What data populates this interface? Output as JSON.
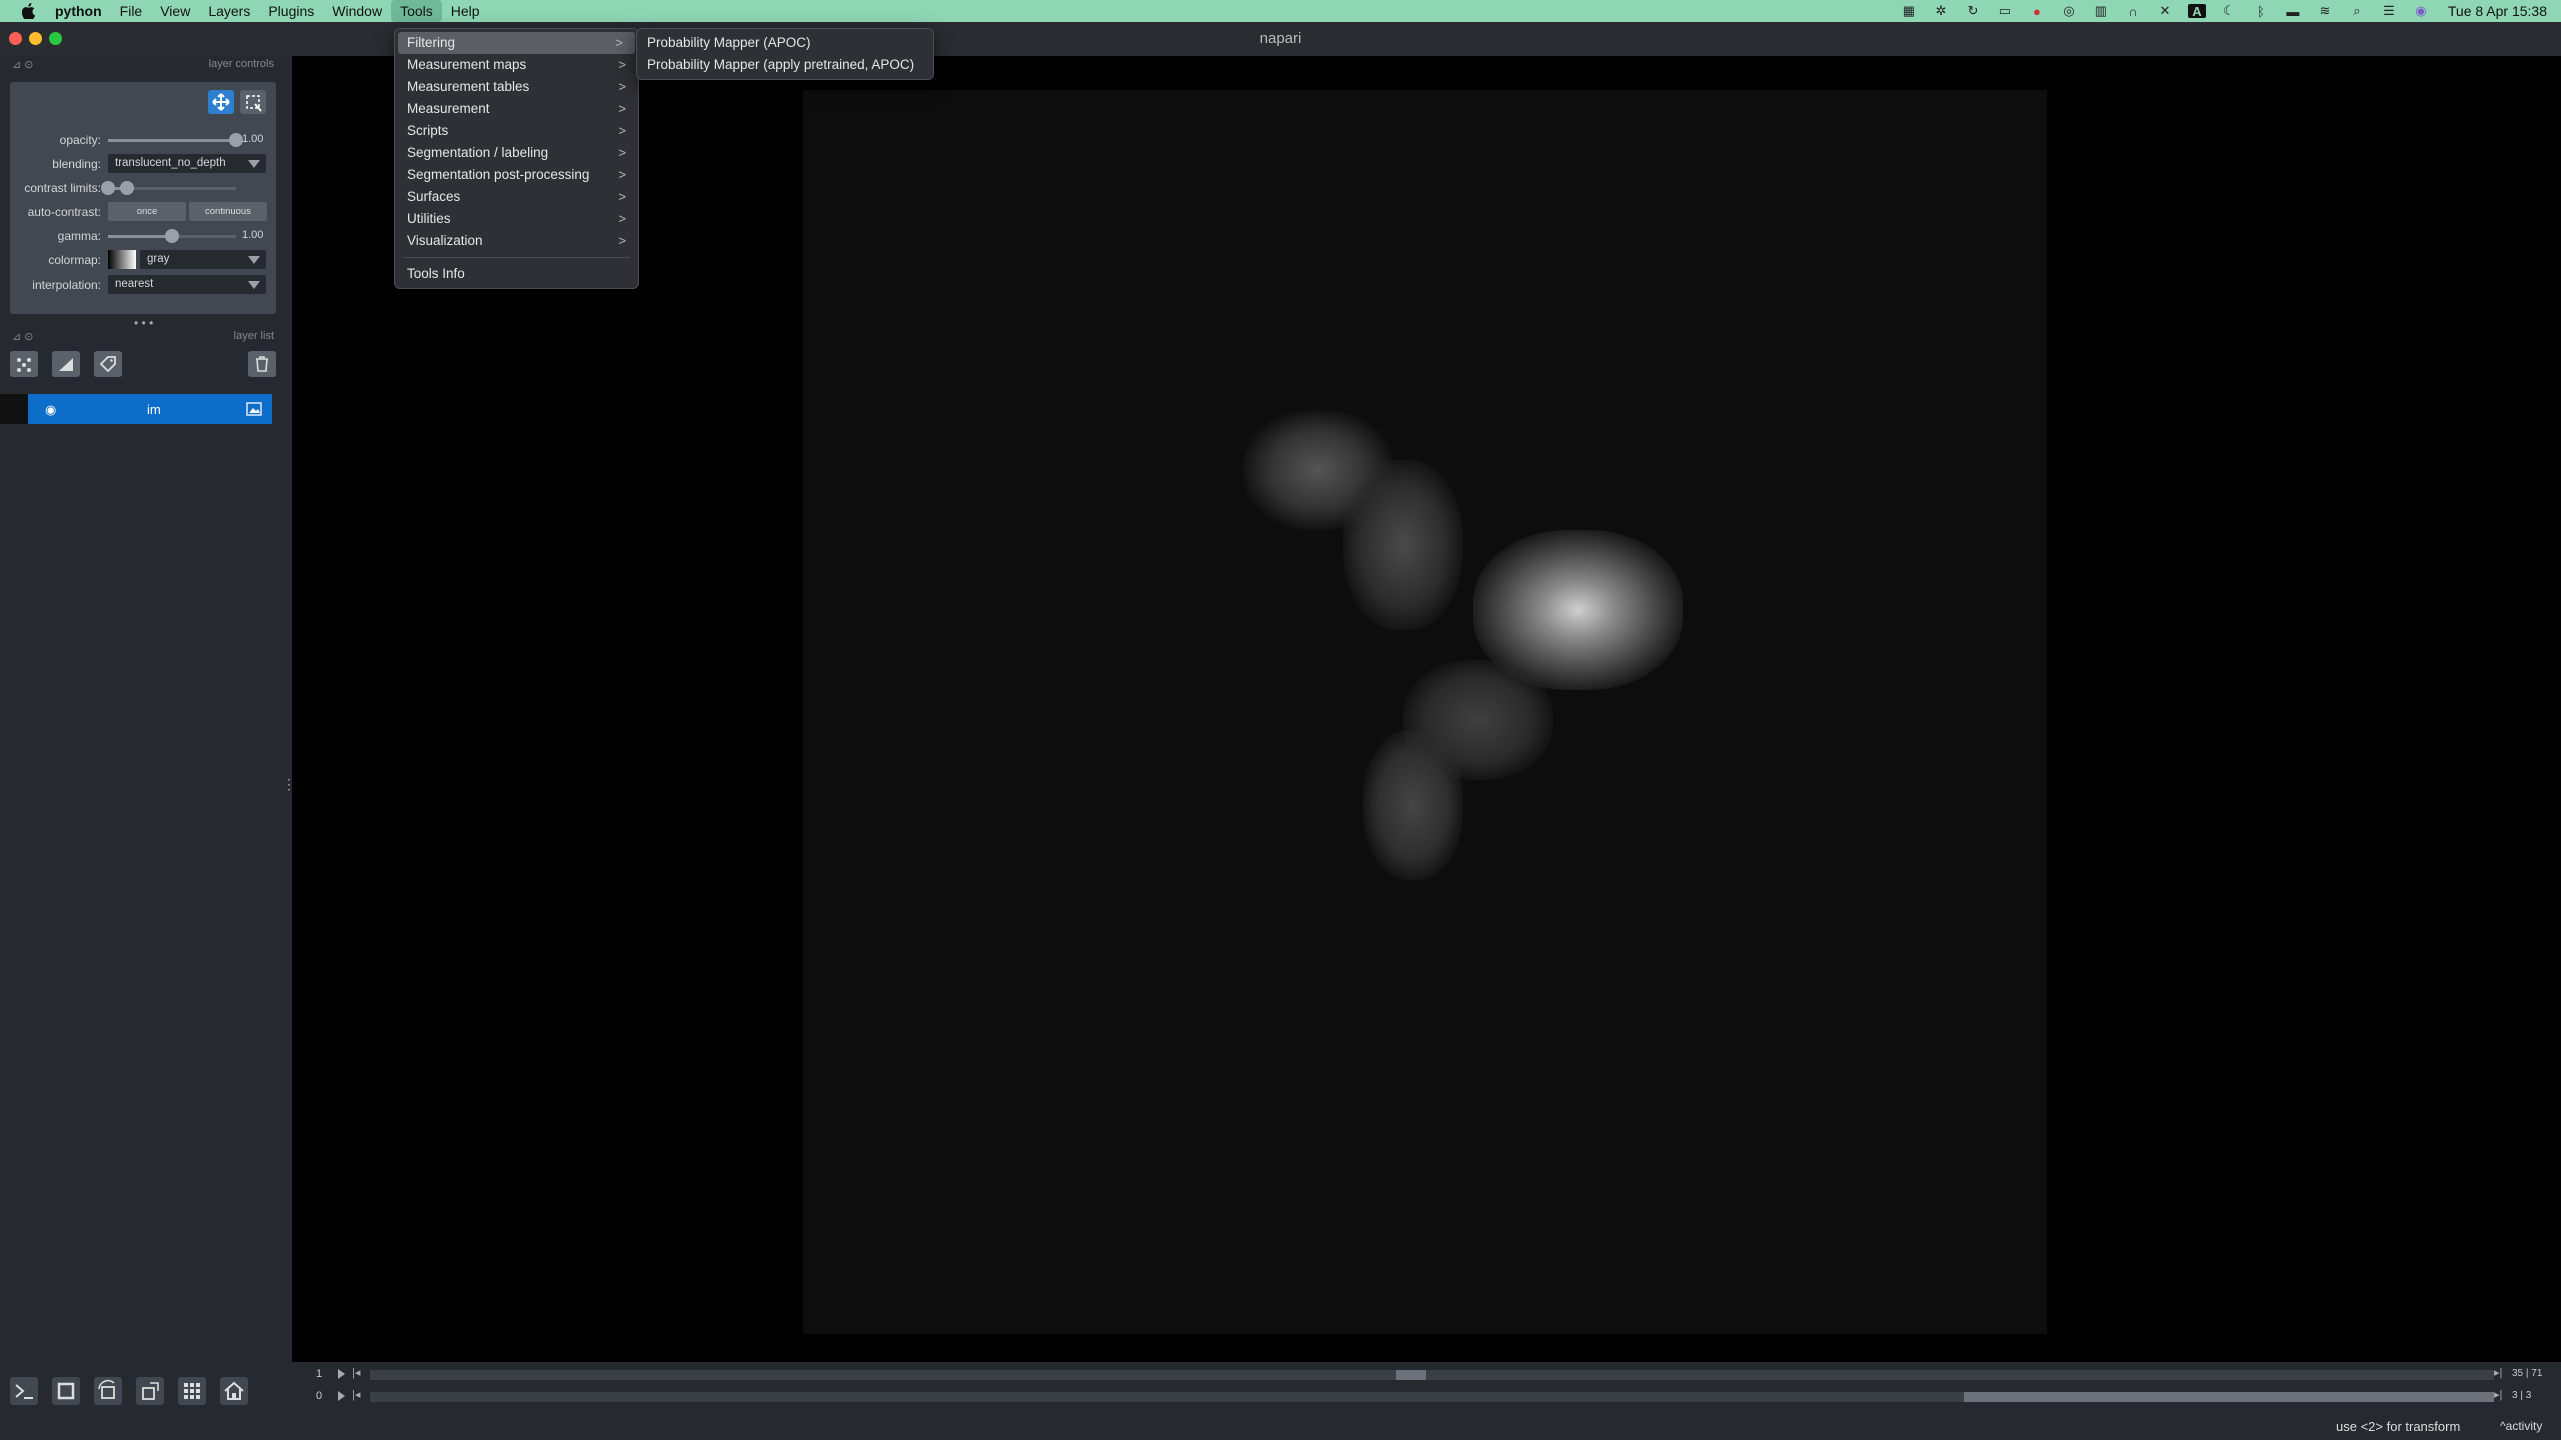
{
  "menubar": {
    "app": "python",
    "items": [
      "File",
      "View",
      "Layers",
      "Plugins",
      "Window",
      "Tools",
      "Help"
    ],
    "active": "Tools",
    "clock": "Tue 8 Apr  15:38",
    "status_icons": [
      "grid-icon",
      "fan-icon",
      "sync-icon",
      "rec-icon",
      "record-icon",
      "compass-icon",
      "panel-icon",
      "headphones-icon",
      "mute-icon",
      "input-source-icon",
      "moon-icon",
      "bluetooth-icon",
      "battery-icon",
      "wifi-icon",
      "search-icon",
      "control-center-icon",
      "siri-icon"
    ],
    "input_source": "A"
  },
  "window": {
    "title": "napari"
  },
  "layer_controls": {
    "title": "layer controls",
    "opacity": {
      "label": "opacity:",
      "value": "1.00",
      "fraction": 1.0
    },
    "blending": {
      "label": "blending:",
      "value": "translucent_no_depth"
    },
    "contrast": {
      "label": "contrast limits:",
      "low": 0.0,
      "high": 0.15
    },
    "auto_contrast": {
      "label": "auto-contrast:",
      "once": "once",
      "continuous": "continuous"
    },
    "gamma": {
      "label": "gamma:",
      "value": "1.00",
      "fraction": 0.5
    },
    "colormap": {
      "label": "colormap:",
      "value": "gray"
    },
    "interpolation": {
      "label": "interpolation:",
      "value": "nearest"
    }
  },
  "layer_list": {
    "title": "layer list",
    "layers": [
      {
        "name": "im"
      }
    ]
  },
  "tools_menu": {
    "items": [
      {
        "label": "Filtering",
        "submenu": true
      },
      {
        "label": "Measurement maps",
        "submenu": true
      },
      {
        "label": "Measurement tables",
        "submenu": true
      },
      {
        "label": "Measurement",
        "submenu": true
      },
      {
        "label": "Scripts",
        "submenu": true
      },
      {
        "label": "Segmentation / labeling",
        "submenu": true
      },
      {
        "label": "Segmentation post-processing",
        "submenu": true
      },
      {
        "label": "Surfaces",
        "submenu": true
      },
      {
        "label": "Utilities",
        "submenu": true
      },
      {
        "label": "Visualization",
        "submenu": true
      }
    ],
    "footer": "Tools Info",
    "arrow": ">"
  },
  "filtering_submenu": {
    "items": [
      "Probability Mapper (APOC)",
      "Probability Mapper (apply pretrained, APOC)"
    ]
  },
  "dims": [
    {
      "index": "1",
      "current": "35",
      "max": "71",
      "position": 0.49
    },
    {
      "index": "0",
      "current": "3",
      "max": "3",
      "position": 1.0
    }
  ],
  "status": {
    "message": "use <2> for transform",
    "activity": "activity"
  },
  "colors": {
    "menubar": "#8fd6b5",
    "panel": "#262930",
    "selected_layer": "#0d6ec9",
    "tool_active": "#2f7fd0"
  }
}
